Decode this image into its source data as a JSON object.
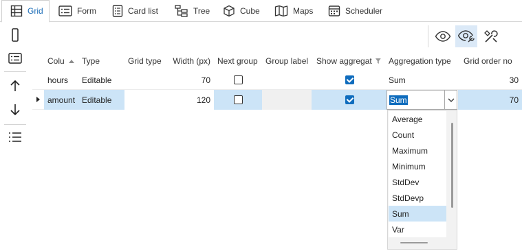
{
  "tabs": [
    {
      "label": "Grid",
      "icon": "grid-icon",
      "active": true
    },
    {
      "label": "Form",
      "icon": "form-icon"
    },
    {
      "label": "Card list",
      "icon": "card-list-icon"
    },
    {
      "label": "Tree",
      "icon": "tree-icon"
    },
    {
      "label": "Cube",
      "icon": "cube-icon"
    },
    {
      "label": "Maps",
      "icon": "map-icon"
    },
    {
      "label": "Scheduler",
      "icon": "scheduler-icon"
    }
  ],
  "left_toolbar": [
    "phone-layout-icon",
    "form-view-icon",
    "move-up-icon",
    "move-down-icon",
    "list-icon"
  ],
  "right_toolbar": [
    "visibility-icon",
    "visibility-settings-icon",
    "column-settings-icon"
  ],
  "grid": {
    "columns": [
      "Colu",
      "Type",
      "Grid type",
      "Width (px)",
      "Next group",
      "Group label",
      "Show aggregati",
      "Aggregation type",
      "Grid order no"
    ],
    "rows": [
      {
        "column": "hours",
        "type": "Editable",
        "grid_type": "",
        "width": "70",
        "next_group": false,
        "group_label": "",
        "show_aggregation": true,
        "aggregation_type": "Sum",
        "grid_order": "30"
      },
      {
        "column": "amount",
        "type": "Editable",
        "grid_type": "",
        "width": "120",
        "next_group": false,
        "group_label": "",
        "show_aggregation": true,
        "aggregation_type": "Sum",
        "grid_order": "70"
      }
    ]
  },
  "dropdown": {
    "options": [
      "Average",
      "Count",
      "Maximum",
      "Minimum",
      "StdDev",
      "StdDevp",
      "Sum",
      "Var"
    ],
    "selected": "Sum"
  },
  "colors": {
    "accent": "#0f6cbd",
    "selection": "#cce4f7"
  }
}
